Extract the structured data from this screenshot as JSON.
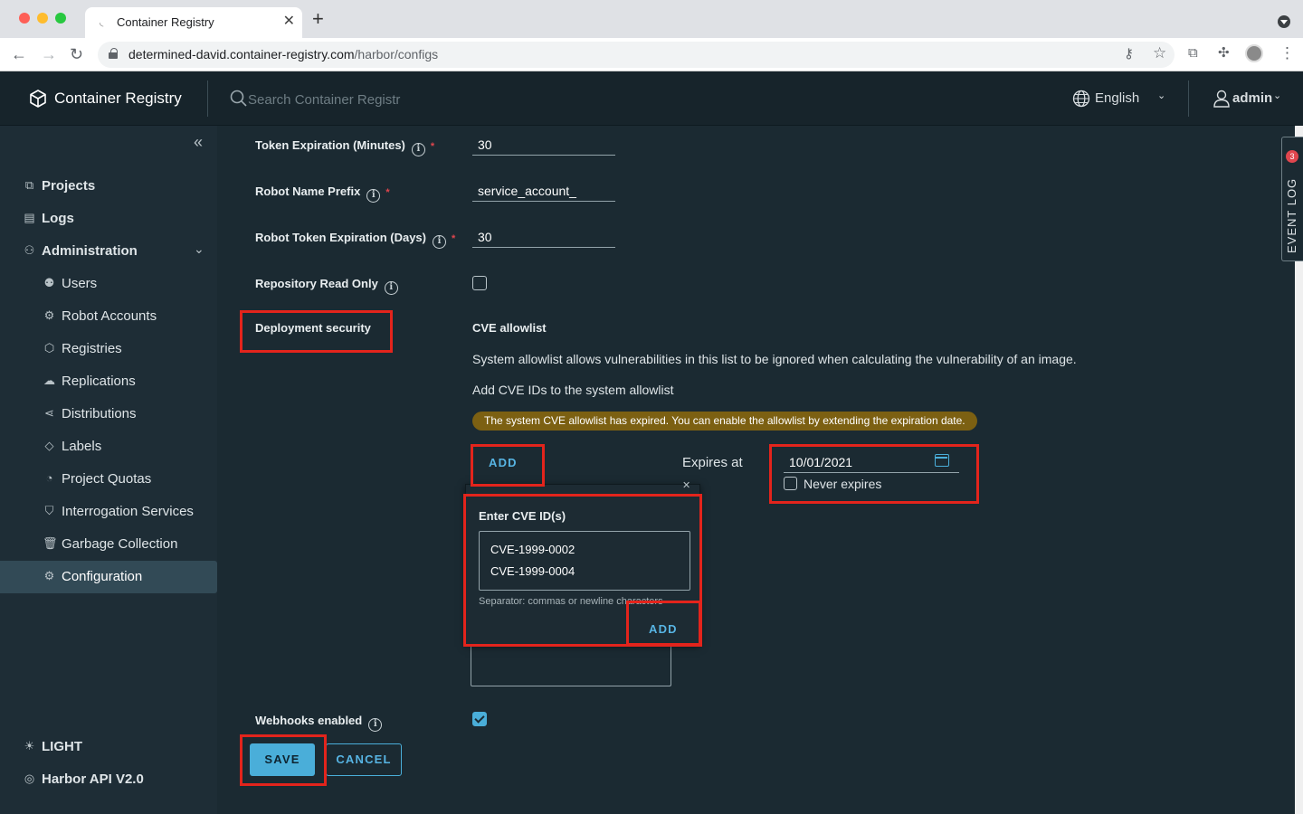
{
  "browser": {
    "tab_title": "Container Registry",
    "url_host": "determined-david.container-registry.com",
    "url_path": "/harbor/configs"
  },
  "header": {
    "brand": "Container Registry",
    "search_placeholder": "Search Container Registr",
    "language": "English",
    "user": "admin"
  },
  "sidebar": {
    "items": [
      {
        "label": "Projects",
        "icon": "projects-icon"
      },
      {
        "label": "Logs",
        "icon": "logs-icon"
      },
      {
        "label": "Administration",
        "icon": "administration-icon"
      },
      {
        "label": "Users",
        "icon": "users-icon"
      },
      {
        "label": "Robot Accounts",
        "icon": "robot-icon"
      },
      {
        "label": "Registries",
        "icon": "registries-icon"
      },
      {
        "label": "Replications",
        "icon": "replications-icon"
      },
      {
        "label": "Distributions",
        "icon": "distributions-icon"
      },
      {
        "label": "Labels",
        "icon": "labels-icon"
      },
      {
        "label": "Project Quotas",
        "icon": "quotas-icon"
      },
      {
        "label": "Interrogation Services",
        "icon": "shield-icon"
      },
      {
        "label": "Garbage Collection",
        "icon": "trash-icon"
      },
      {
        "label": "Configuration",
        "icon": "gear-icon"
      }
    ],
    "theme_toggle": "LIGHT",
    "api_link": "Harbor API V2.0"
  },
  "form": {
    "token_expiration_label": "Token Expiration (Minutes)",
    "token_expiration_value": "30",
    "robot_prefix_label": "Robot Name Prefix",
    "robot_prefix_value": "service_account_",
    "robot_token_label": "Robot Token Expiration (Days)",
    "robot_token_value": "30",
    "repo_read_only_label": "Repository Read Only",
    "repo_read_only_checked": false,
    "deployment_security_label": "Deployment security",
    "cve_title": "CVE allowlist",
    "cve_desc": "System allowlist allows vulnerabilities in this list to be ignored when calculating the vulnerability of an image.",
    "cve_add_hint": "Add CVE IDs to the system allowlist",
    "expired_warning": "The system CVE allowlist has expired. You can enable the allowlist by extending the expiration date.",
    "add_label": "ADD",
    "expires_label": "Expires at",
    "expires_value": "10/01/2021",
    "never_expires_label": "Never expires",
    "webhooks_label": "Webhooks enabled",
    "webhooks_checked": true,
    "save_label": "SAVE",
    "cancel_label": "CANCEL"
  },
  "popover": {
    "title": "Enter CVE ID(s)",
    "cve_ids": [
      "CVE-1999-0002",
      "CVE-1999-0004"
    ],
    "help": "Separator: commas or newline characters",
    "add_label": "ADD"
  },
  "event_log": {
    "label": "EVENT LOG",
    "count": "3"
  },
  "colors": {
    "accent": "#4aaed9",
    "highlight": "#e3241c",
    "warning": "#7c6012"
  }
}
